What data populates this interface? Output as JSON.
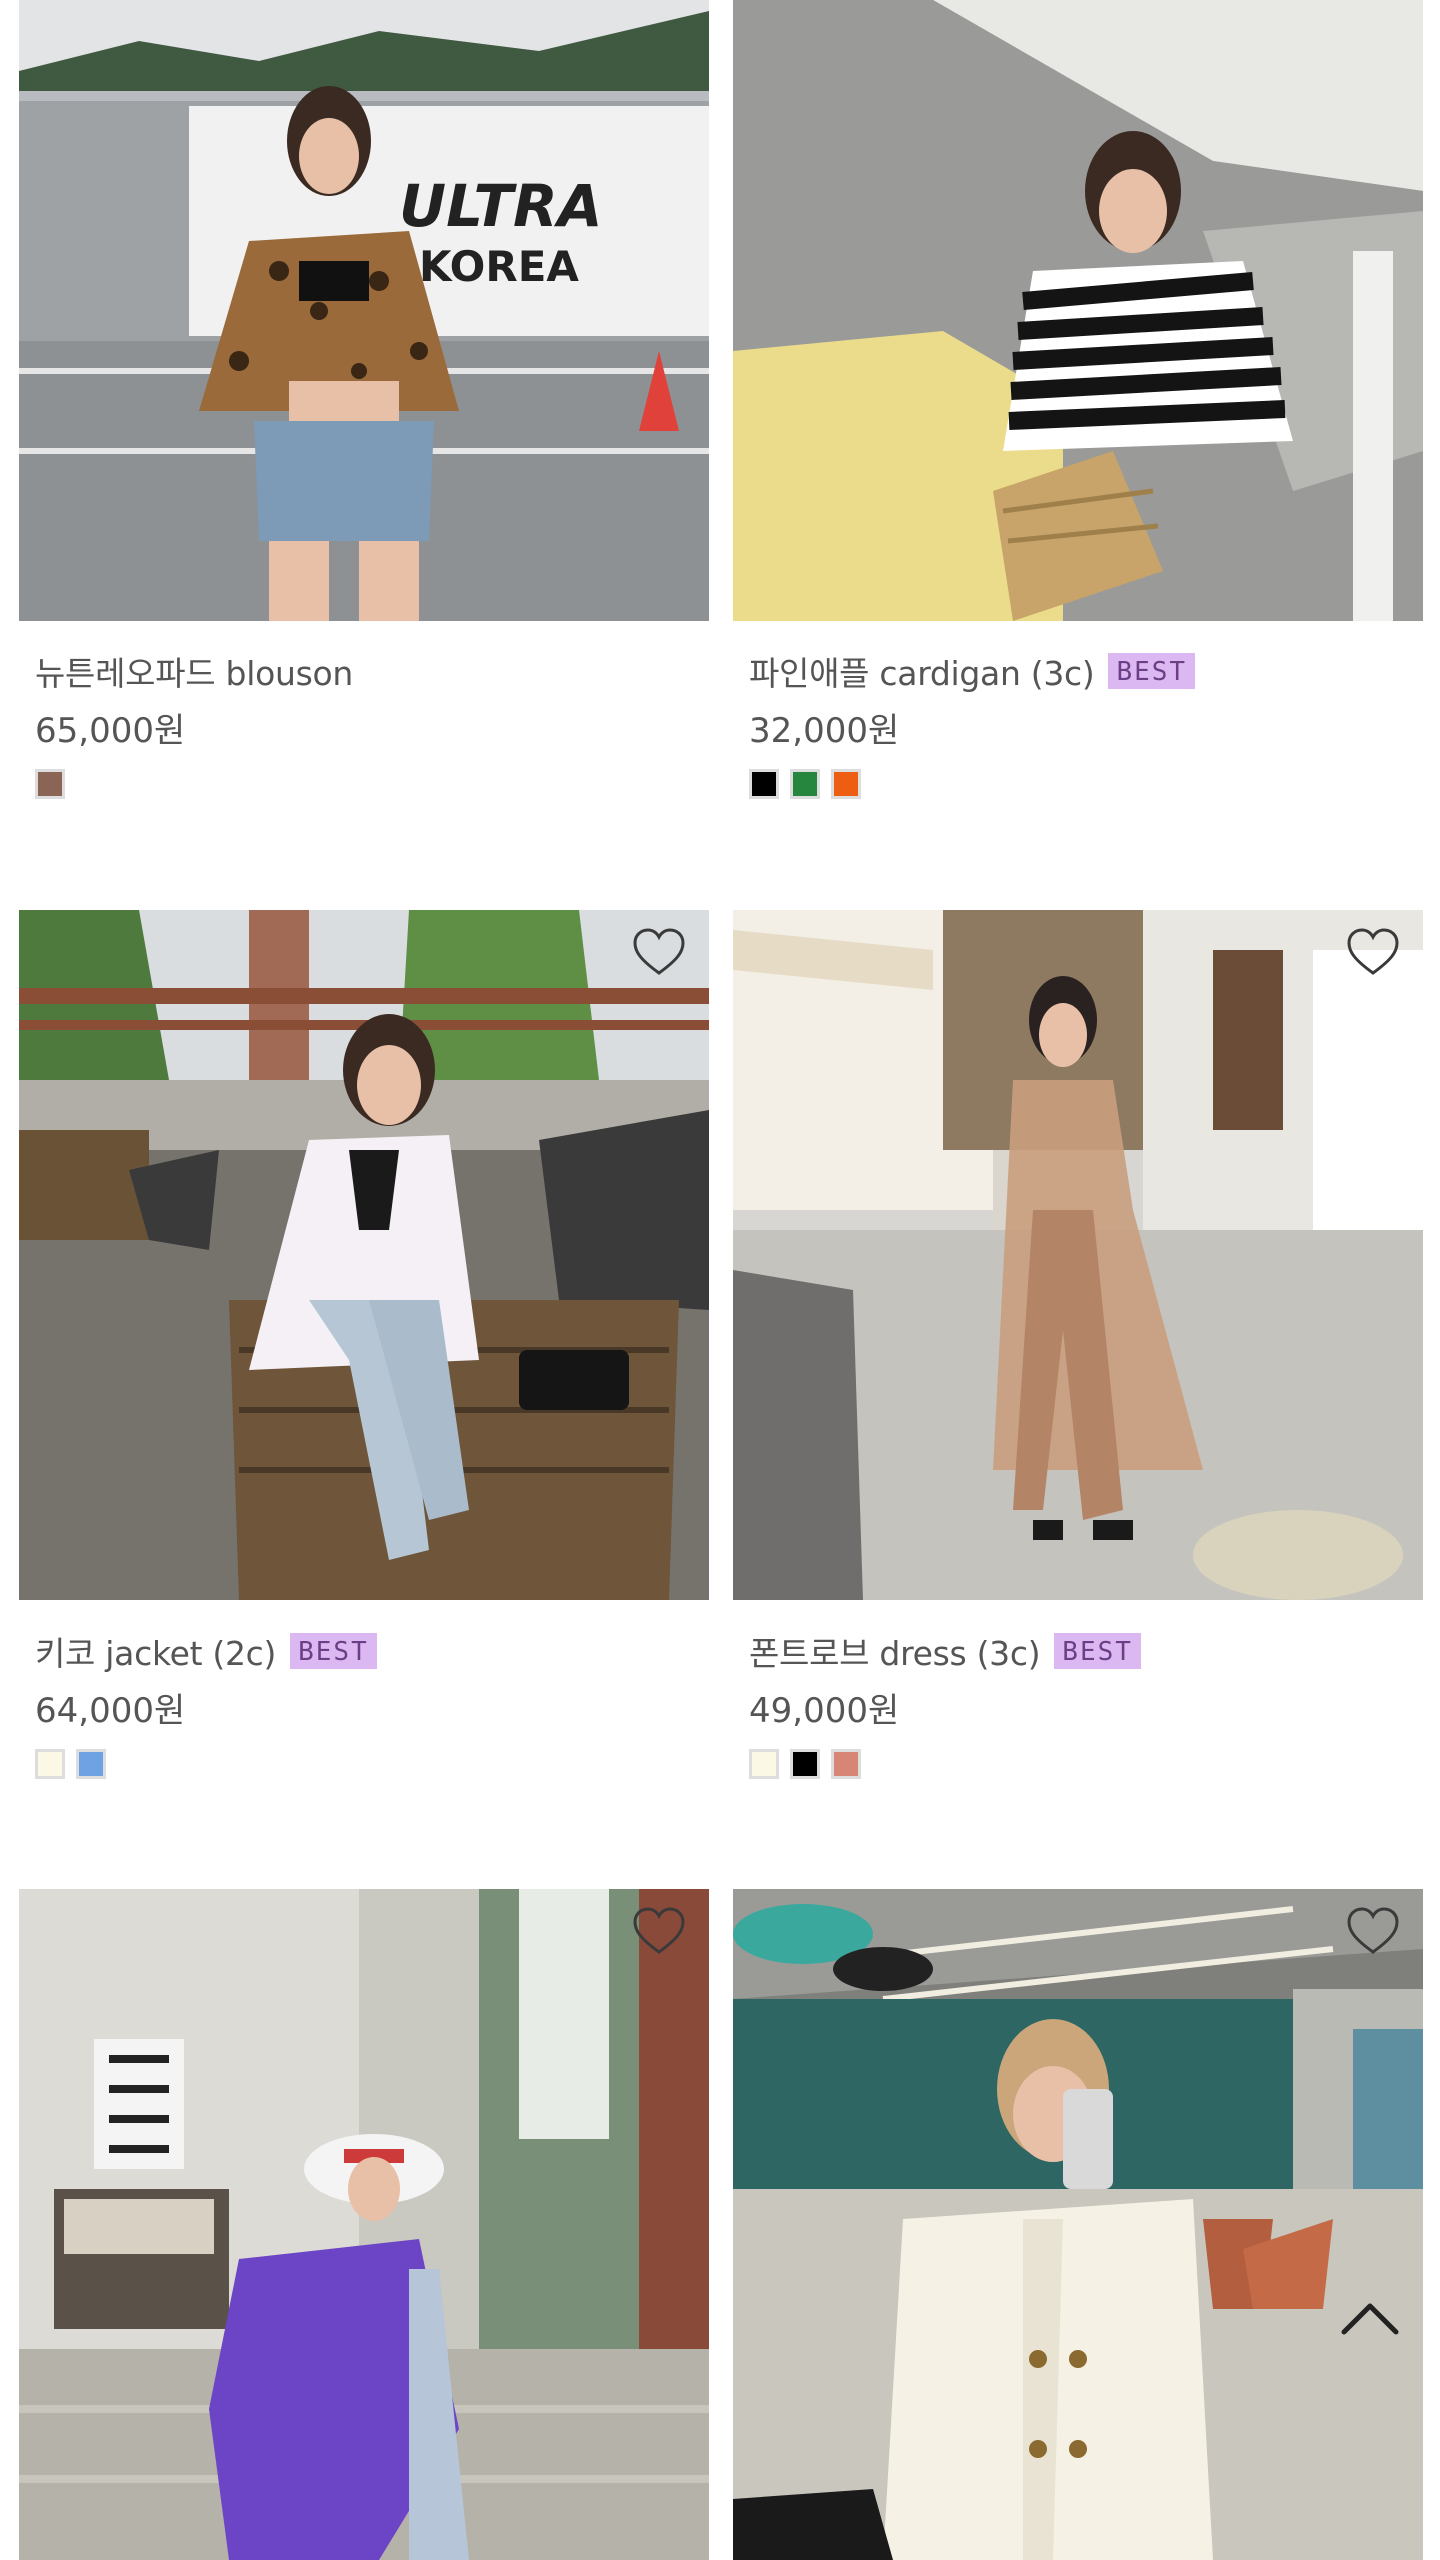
{
  "products": [
    {
      "name": "뉴튼레오파드 blouson",
      "badge": "",
      "price": "65,000원",
      "swatches": [
        "#8a6555"
      ],
      "image_icon": "product-photo-leopard-blouson",
      "show_heart": false
    },
    {
      "name": "파인애플 cardigan (3c)",
      "badge": "BEST",
      "price": "32,000원",
      "swatches": [
        "#000000",
        "#27863e",
        "#ee5e12"
      ],
      "image_icon": "product-photo-striped-cardigan",
      "show_heart": false
    },
    {
      "name": "키코 jacket (2c)",
      "badge": "BEST",
      "price": "64,000원",
      "swatches": [
        "#fbf9e6",
        "#6ea2e3"
      ],
      "image_icon": "product-photo-white-jacket",
      "show_heart": true
    },
    {
      "name": "폰트로브 dress (3c)",
      "badge": "BEST",
      "price": "49,000원",
      "swatches": [
        "#fbf9e6",
        "#000000",
        "#d78574"
      ],
      "image_icon": "product-photo-beige-dress",
      "show_heart": true
    },
    {
      "name": "",
      "badge": "",
      "price": "",
      "swatches": [],
      "image_icon": "product-photo-purple-jacket",
      "show_heart": true
    },
    {
      "name": "",
      "badge": "",
      "price": "",
      "swatches": [],
      "image_icon": "product-photo-white-blouse",
      "show_heart": true
    }
  ],
  "icons": {
    "heart": "heart-icon",
    "scroll_top": "chevron-up-icon"
  },
  "colors": {
    "badge_bg": "#dcb8f2",
    "badge_text": "#6b3f86",
    "text": "#555555"
  }
}
